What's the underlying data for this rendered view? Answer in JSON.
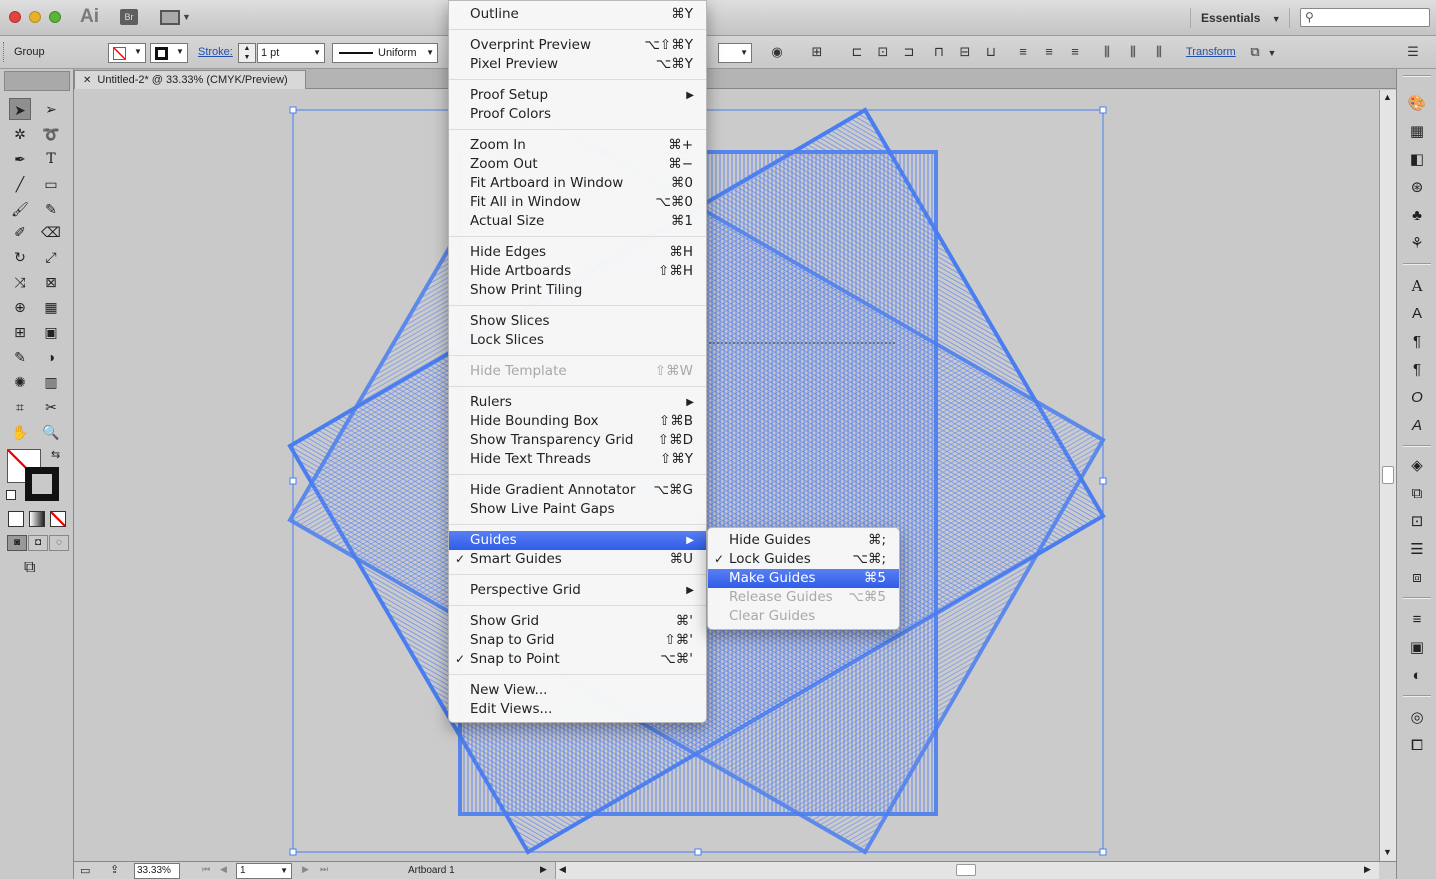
{
  "app": {
    "logo": "Ai",
    "bridge": "Br",
    "workspace": "Essentials",
    "search_placeholder": ""
  },
  "control": {
    "selection": "Group",
    "stroke_label": "Stroke:",
    "stroke_weight": "1 pt",
    "profile": "Uniform",
    "transform_label": "Transform"
  },
  "document": {
    "tab_title": "Untitled-2* @ 33.33% (CMYK/Preview)"
  },
  "status": {
    "zoom": "33.33%",
    "artboard_number": "1",
    "artboard_name": "Artboard 1"
  },
  "view_menu": [
    {
      "label": "Outline",
      "shortcut": "⌘Y"
    },
    {
      "sep": true
    },
    {
      "label": "Overprint Preview",
      "shortcut": "⌥⇧⌘Y"
    },
    {
      "label": "Pixel Preview",
      "shortcut": "⌥⌘Y"
    },
    {
      "sep": true
    },
    {
      "label": "Proof Setup",
      "submenu": true
    },
    {
      "label": "Proof Colors"
    },
    {
      "sep": true
    },
    {
      "label": "Zoom In",
      "shortcut": "⌘+"
    },
    {
      "label": "Zoom Out",
      "shortcut": "⌘−"
    },
    {
      "label": "Fit Artboard in Window",
      "shortcut": "⌘0"
    },
    {
      "label": "Fit All in Window",
      "shortcut": "⌥⌘0"
    },
    {
      "label": "Actual Size",
      "shortcut": "⌘1"
    },
    {
      "sep": true
    },
    {
      "label": "Hide Edges",
      "shortcut": "⌘H"
    },
    {
      "label": "Hide Artboards",
      "shortcut": "⇧⌘H"
    },
    {
      "label": "Show Print Tiling"
    },
    {
      "sep": true
    },
    {
      "label": "Show Slices"
    },
    {
      "label": "Lock Slices"
    },
    {
      "sep": true
    },
    {
      "label": "Hide Template",
      "shortcut": "⇧⌘W",
      "disabled": true
    },
    {
      "sep": true
    },
    {
      "label": "Rulers",
      "submenu": true
    },
    {
      "label": "Hide Bounding Box",
      "shortcut": "⇧⌘B"
    },
    {
      "label": "Show Transparency Grid",
      "shortcut": "⇧⌘D"
    },
    {
      "label": "Hide Text Threads",
      "shortcut": "⇧⌘Y"
    },
    {
      "sep": true
    },
    {
      "label": "Hide Gradient Annotator",
      "shortcut": "⌥⌘G"
    },
    {
      "label": "Show Live Paint Gaps"
    },
    {
      "sep": true
    },
    {
      "label": "Guides",
      "submenu": true,
      "highlighted": true
    },
    {
      "label": "Smart Guides",
      "shortcut": "⌘U",
      "checked": true
    },
    {
      "sep": true
    },
    {
      "label": "Perspective Grid",
      "submenu": true
    },
    {
      "sep": true
    },
    {
      "label": "Show Grid",
      "shortcut": "⌘'"
    },
    {
      "label": "Snap to Grid",
      "shortcut": "⇧⌘'"
    },
    {
      "label": "Snap to Point",
      "shortcut": "⌥⌘'",
      "checked": true
    },
    {
      "sep": true
    },
    {
      "label": "New View..."
    },
    {
      "label": "Edit Views..."
    }
  ],
  "guides_menu": [
    {
      "label": "Hide Guides",
      "shortcut": "⌘;"
    },
    {
      "label": "Lock Guides",
      "shortcut": "⌥⌘;",
      "checked": true
    },
    {
      "label": "Make Guides",
      "shortcut": "⌘5",
      "highlighted": true
    },
    {
      "label": "Release Guides",
      "shortcut": "⌥⌘5",
      "disabled": true
    },
    {
      "label": "Clear Guides",
      "disabled": true
    }
  ],
  "colors": {
    "selection_blue": "#4a7ef0",
    "menu_highlight": "#3a66ea"
  }
}
